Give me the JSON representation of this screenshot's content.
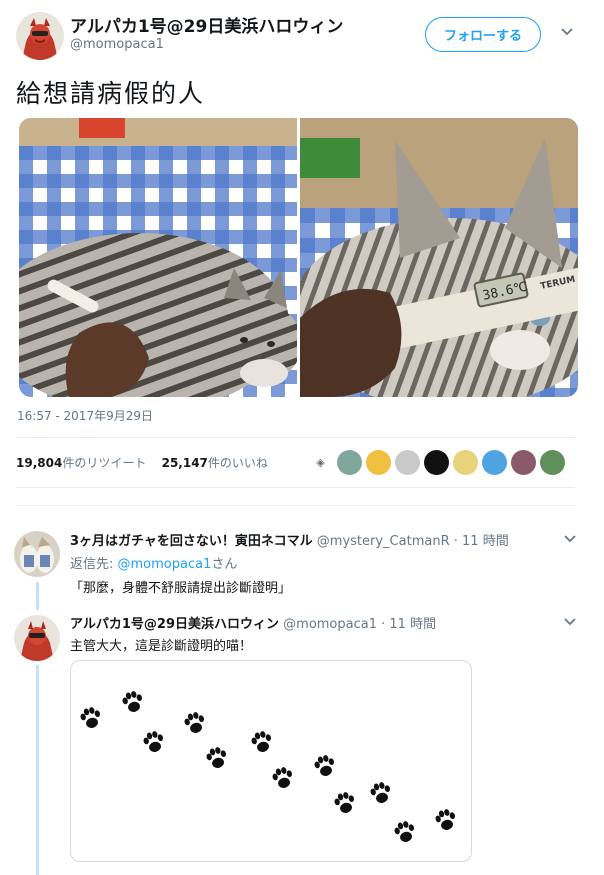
{
  "author": {
    "name": "アルパカ1号@29日美浜ハロウィン",
    "handle": "@momopaca1",
    "follow_label": "フォローする"
  },
  "tweet": {
    "text": "給想請病假的人",
    "timestamp": "16:57 - 2017年9月29日",
    "thermometer_reading": "38.6℃",
    "thermometer_brand": "TERUM",
    "retweets": {
      "count": "19,804",
      "label": "件のリツイート"
    },
    "likes": {
      "count": "25,147",
      "label": "件のいいね"
    }
  },
  "reply1": {
    "name": "3ヶ月はガチャを回さない！寅田ネコマル",
    "handle": "@mystery_CatmanR",
    "time": "11 時間",
    "replying_prefix": "返信先: ",
    "replying_handle": "@momopaca1",
    "replying_suffix": "さん",
    "text": "「那麼，身體不舒服請提出診斷證明」"
  },
  "reply2": {
    "name": "アルパカ1号@29日美浜ハロウィン",
    "handle": "@momopaca1",
    "time": "11 時間",
    "text": "主管大大，這是診斷證明的喵！"
  },
  "colors": {
    "accent": "#1da1f2",
    "secondary_text": "#657786",
    "thread_line": "#c4e4f6",
    "divider": "#e6ecf0"
  },
  "icons": [
    "chevron-down-icon",
    "paw-print-icon"
  ]
}
